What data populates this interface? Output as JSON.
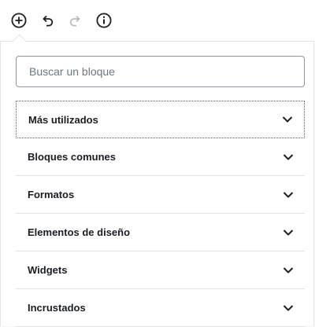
{
  "toolbar": {
    "buttons": [
      {
        "icon": "plus-circle-icon"
      },
      {
        "icon": "undo-icon"
      },
      {
        "icon": "redo-icon"
      },
      {
        "icon": "info-icon"
      }
    ]
  },
  "inserter": {
    "search": {
      "value": "",
      "placeholder": "Buscar un bloque"
    },
    "panels": [
      {
        "label": "Más utilizados",
        "focused": true
      },
      {
        "label": "Bloques comunes",
        "focused": false
      },
      {
        "label": "Formatos",
        "focused": false
      },
      {
        "label": "Elementos de diseño",
        "focused": false
      },
      {
        "label": "Widgets",
        "focused": false
      },
      {
        "label": "Incrustados",
        "focused": false
      }
    ]
  },
  "colors": {
    "text": "#1e1e1e",
    "icon_enabled": "#1e1e1e",
    "icon_disabled": "#b5bcc2",
    "border": "#e2e4e7",
    "input_border": "#8d96a0",
    "focus_outline": "#555d66"
  }
}
